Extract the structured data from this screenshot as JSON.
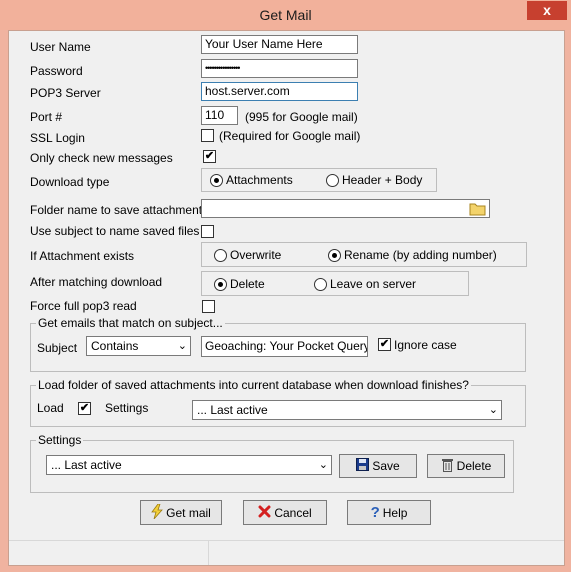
{
  "window": {
    "title": "Get Mail",
    "close_glyph": "x"
  },
  "form": {
    "user_name": {
      "label": "User Name",
      "value": "Your User Name Here"
    },
    "password": {
      "label": "Password",
      "value": "••••••••••••••••"
    },
    "pop3_server": {
      "label": "POP3 Server",
      "value": "host.server.com"
    },
    "port": {
      "label": "Port #",
      "value": "110",
      "hint": "(995 for Google mail)"
    },
    "ssl_login": {
      "label": "SSL Login",
      "checked": false,
      "hint": "(Required for Google mail)"
    },
    "only_new": {
      "label": "Only check new messages",
      "checked": true
    },
    "download_type": {
      "label": "Download type",
      "options": [
        "Attachments",
        "Header + Body"
      ],
      "selected": "Attachments"
    },
    "folder_name": {
      "label": "Folder name to save attachments",
      "value": ""
    },
    "use_subject": {
      "label": "Use subject to name saved files",
      "checked": false
    },
    "if_attachment_exists": {
      "label": "If Attachment exists",
      "options": [
        "Overwrite",
        "Rename (by adding number)"
      ],
      "selected": "Rename (by adding number)"
    },
    "after_matching": {
      "label": "After matching download",
      "options": [
        "Delete",
        "Leave on server"
      ],
      "selected": "Delete"
    },
    "force_full": {
      "label": "Force full pop3 read",
      "checked": false
    }
  },
  "subject_group": {
    "title": "Get emails that match on subject...",
    "subject_label": "Subject",
    "operator": "Contains",
    "value": "Geoaching: Your Pocket Query",
    "ignore_case_label": "Ignore case",
    "ignore_case": true
  },
  "load_group": {
    "title": "Load folder of saved attachments into current database when download finishes?",
    "load_label": "Load",
    "load_checked": true,
    "settings_label": "Settings",
    "settings_value": "... Last active"
  },
  "settings_group": {
    "title": "Settings",
    "value": "... Last active",
    "save_label": "Save",
    "delete_label": "Delete"
  },
  "buttons": {
    "get_mail": "Get mail",
    "cancel": "Cancel",
    "help": "Help"
  },
  "icons": {
    "folder": "folder-icon",
    "save": "floppy-disk-icon",
    "delete": "trash-icon",
    "get_mail": "lightning-icon",
    "cancel": "red-x-icon",
    "help": "question-icon"
  },
  "colors": {
    "titlebar": "#f2b19b",
    "close": "#c7402f",
    "client": "#f0f0f0"
  }
}
